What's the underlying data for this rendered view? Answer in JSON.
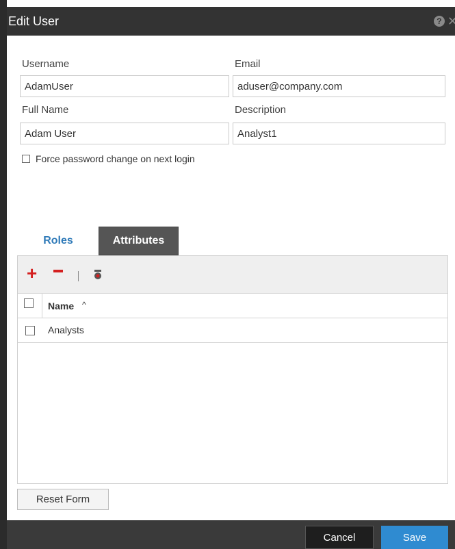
{
  "dialog": {
    "title": "Edit User"
  },
  "form": {
    "username_label": "Username",
    "username_value": "AdamUser",
    "email_label": "Email",
    "email_value": "aduser@company.com",
    "fullname_label": "Full Name",
    "fullname_value": "Adam User",
    "description_label": "Description",
    "description_value": "Analyst1",
    "force_password_label": "Force password change on next login",
    "force_password_checked": false
  },
  "tabs": [
    {
      "label": "Roles",
      "active": true
    },
    {
      "label": "Attributes",
      "active": false
    }
  ],
  "roles_grid": {
    "column_header": "Name",
    "sort_indicator": "^",
    "rows": [
      {
        "name": "Analysts",
        "checked": false
      }
    ]
  },
  "buttons": {
    "reset": "Reset Form",
    "cancel": "Cancel",
    "save": "Save"
  },
  "icons": {
    "help": "question-circle",
    "close": "x",
    "add": "plus",
    "remove": "minus",
    "roles": "role-badge"
  },
  "colors": {
    "accent": "#2f7ab8",
    "save": "#2f8bd1",
    "danger": "#d42020",
    "titlebar": "#333333"
  }
}
